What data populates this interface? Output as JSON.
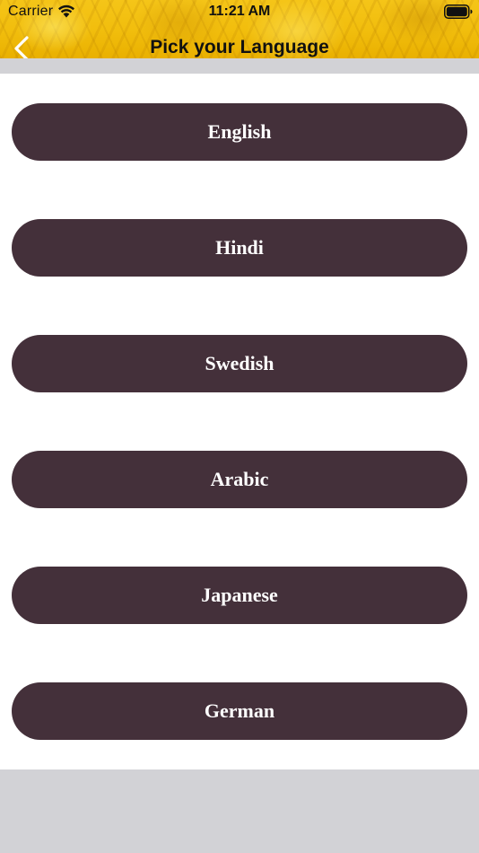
{
  "status_bar": {
    "carrier": "Carrier",
    "time": "11:21 AM",
    "wifi_icon": "wifi-icon",
    "battery_icon": "battery-icon"
  },
  "nav": {
    "title": "Pick your Language",
    "back_icon": "chevron-left-icon"
  },
  "languages": [
    {
      "label": "English"
    },
    {
      "label": "Hindi"
    },
    {
      "label": "Swedish"
    },
    {
      "label": "Arabic"
    },
    {
      "label": "Japanese"
    },
    {
      "label": "German"
    }
  ],
  "colors": {
    "header_gold": "#f1bd0c",
    "button_bg": "#44303a",
    "button_text": "#ffffff",
    "content_bg": "#ffffff",
    "footer_bg": "#d2d2d6"
  }
}
